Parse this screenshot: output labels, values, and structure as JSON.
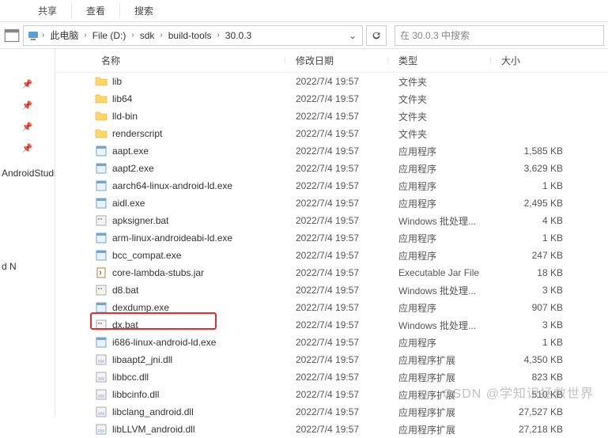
{
  "tabs": {
    "share": "共享",
    "view": "查看",
    "search": "搜索"
  },
  "breadcrumb": [
    "此电脑",
    "File (D:)",
    "sdk",
    "build-tools",
    "30.0.3"
  ],
  "search_placeholder": "在 30.0.3 中搜索",
  "columns": {
    "name": "名称",
    "date": "修改日期",
    "type": "类型",
    "size": "大小"
  },
  "sidebar": {
    "items": [
      "",
      "",
      "",
      "",
      "AndroidStudio",
      "",
      "",
      "",
      "d N"
    ]
  },
  "files": [
    {
      "icon": "folder",
      "name": "lib",
      "date": "2022/7/4 19:57",
      "type": "文件夹",
      "size": ""
    },
    {
      "icon": "folder",
      "name": "lib64",
      "date": "2022/7/4 19:57",
      "type": "文件夹",
      "size": ""
    },
    {
      "icon": "folder",
      "name": "lld-bin",
      "date": "2022/7/4 19:57",
      "type": "文件夹",
      "size": ""
    },
    {
      "icon": "folder",
      "name": "renderscript",
      "date": "2022/7/4 19:57",
      "type": "文件夹",
      "size": ""
    },
    {
      "icon": "exe",
      "name": "aapt.exe",
      "date": "2022/7/4 19:57",
      "type": "应用程序",
      "size": "1,585 KB"
    },
    {
      "icon": "exe",
      "name": "aapt2.exe",
      "date": "2022/7/4 19:57",
      "type": "应用程序",
      "size": "3,629 KB"
    },
    {
      "icon": "exe",
      "name": "aarch64-linux-android-ld.exe",
      "date": "2022/7/4 19:57",
      "type": "应用程序",
      "size": "1 KB"
    },
    {
      "icon": "exe",
      "name": "aidl.exe",
      "date": "2022/7/4 19:57",
      "type": "应用程序",
      "size": "2,495 KB"
    },
    {
      "icon": "bat",
      "name": "apksigner.bat",
      "date": "2022/7/4 19:57",
      "type": "Windows 批处理...",
      "size": "4 KB"
    },
    {
      "icon": "exe",
      "name": "arm-linux-androideabi-ld.exe",
      "date": "2022/7/4 19:57",
      "type": "应用程序",
      "size": "1 KB"
    },
    {
      "icon": "exe",
      "name": "bcc_compat.exe",
      "date": "2022/7/4 19:57",
      "type": "应用程序",
      "size": "247 KB"
    },
    {
      "icon": "jar",
      "name": "core-lambda-stubs.jar",
      "date": "2022/7/4 19:57",
      "type": "Executable Jar File",
      "size": "18 KB"
    },
    {
      "icon": "bat",
      "name": "d8.bat",
      "date": "2022/7/4 19:57",
      "type": "Windows 批处理...",
      "size": "3 KB"
    },
    {
      "icon": "exe",
      "name": "dexdump.exe",
      "date": "2022/7/4 19:57",
      "type": "应用程序",
      "size": "907 KB"
    },
    {
      "icon": "bat",
      "name": "dx.bat",
      "date": "2022/7/4 19:57",
      "type": "Windows 批处理...",
      "size": "3 KB"
    },
    {
      "icon": "exe",
      "name": "i686-linux-android-ld.exe",
      "date": "2022/7/4 19:57",
      "type": "应用程序",
      "size": "1 KB"
    },
    {
      "icon": "dll",
      "name": "libaapt2_jni.dll",
      "date": "2022/7/4 19:57",
      "type": "应用程序扩展",
      "size": "4,350 KB"
    },
    {
      "icon": "dll",
      "name": "libbcc.dll",
      "date": "2022/7/4 19:57",
      "type": "应用程序扩展",
      "size": "823 KB"
    },
    {
      "icon": "dll",
      "name": "libbcinfo.dll",
      "date": "2022/7/4 19:57",
      "type": "应用程序扩展",
      "size": "510 KB"
    },
    {
      "icon": "dll",
      "name": "libclang_android.dll",
      "date": "2022/7/4 19:57",
      "type": "应用程序扩展",
      "size": "27,527 KB"
    },
    {
      "icon": "dll",
      "name": "libLLVM_android.dll",
      "date": "2022/7/4 19:57",
      "type": "应用程序扩展",
      "size": "27,218 KB"
    }
  ],
  "watermark": "CSDN @学知识拯救世界"
}
